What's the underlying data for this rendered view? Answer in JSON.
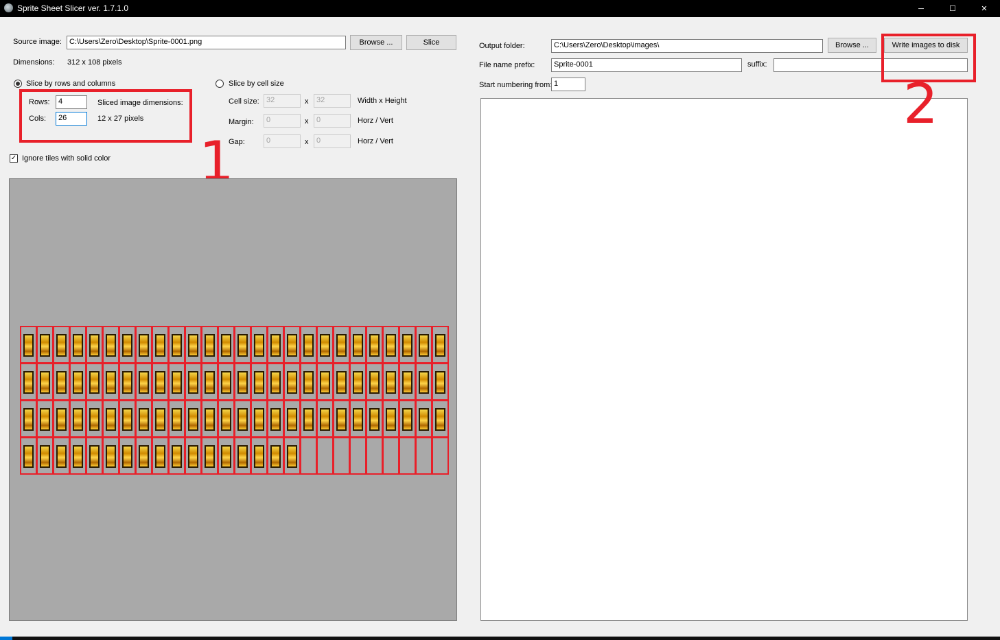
{
  "window": {
    "title": "Sprite Sheet Slicer ver. 1.7.1.0",
    "controls": {
      "minimize": "─",
      "maximize": "☐",
      "close": "✕"
    }
  },
  "source": {
    "label": "Source image:",
    "path": "C:\\Users\\Zero\\Desktop\\Sprite-0001.png",
    "browse_label": "Browse ...",
    "slice_label": "Slice",
    "dimensions_label": "Dimensions:",
    "dimensions_value": "312 x 108 pixels"
  },
  "slice_rows_cols": {
    "label": "Slice by rows and columns",
    "selected": true,
    "rows_label": "Rows:",
    "rows_value": "4",
    "cols_label": "Cols:",
    "cols_value": "26",
    "sliced_dims_label": "Sliced image dimensions:",
    "sliced_dims_value": "12 x 27 pixels"
  },
  "slice_cell_size": {
    "label": "Slice by cell size",
    "selected": false,
    "cell_size_label": "Cell size:",
    "cell_w": "32",
    "cell_h": "32",
    "cell_hint": "Width x Height",
    "margin_label": "Margin:",
    "margin_h": "0",
    "margin_v": "0",
    "margin_hint": "Horz / Vert",
    "gap_label": "Gap:",
    "gap_h": "0",
    "gap_v": "0",
    "gap_hint": "Horz / Vert",
    "separator": "x"
  },
  "ignore_solid": {
    "label": "Ignore tiles with solid color",
    "checked": true,
    "check_glyph": "✓"
  },
  "output": {
    "folder_label": "Output folder:",
    "folder_value": "C:\\Users\\Zero\\Desktop\\images\\",
    "browse_label": "Browse ...",
    "write_label": "Write images to disk",
    "prefix_label": "File name prefix:",
    "prefix_value": "Sprite-0001",
    "suffix_label": "suffix:",
    "suffix_value": "",
    "start_label": "Start numbering from:",
    "start_value": "1"
  },
  "annotations": {
    "marker_1": "1",
    "marker_2": "2",
    "highlight_color": "#e8202a"
  },
  "sprite_sheet": {
    "rows": 4,
    "cols": 26,
    "filled_per_row": [
      26,
      26,
      26,
      17
    ],
    "glyph_color": "#f0b800",
    "grid_color": "#e8202a"
  }
}
